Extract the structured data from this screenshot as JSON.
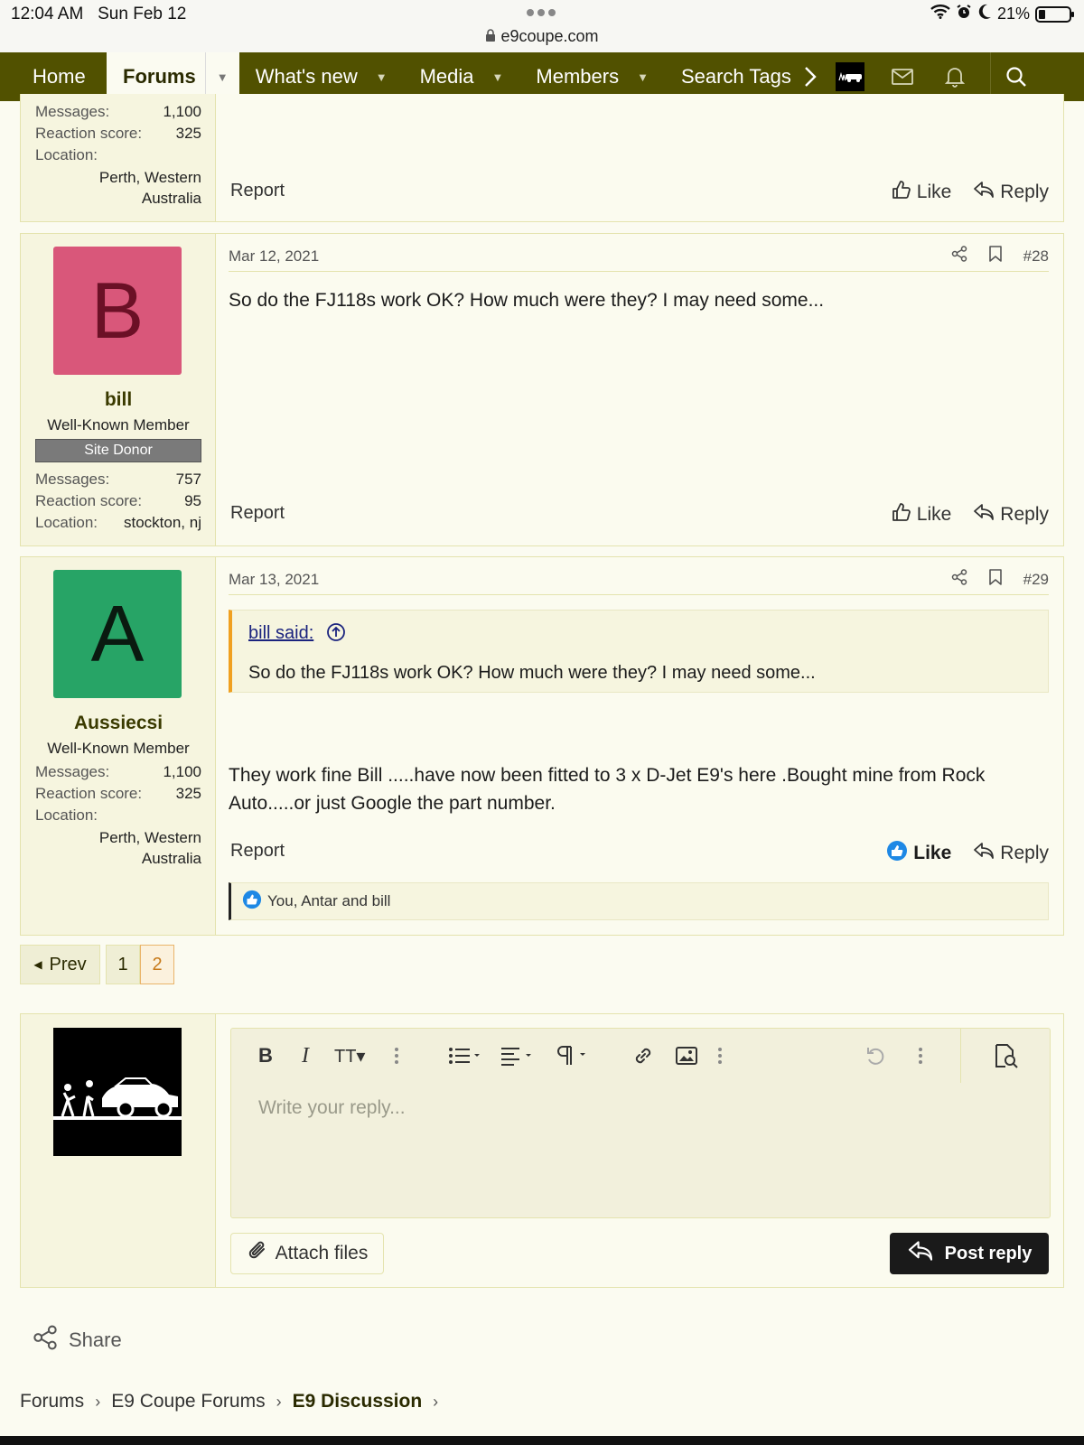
{
  "status_bar": {
    "time": "12:04 AM",
    "date": "Sun Feb 12",
    "url": "e9coupe.com",
    "battery": "21%"
  },
  "nav": {
    "home": "Home",
    "forums": "Forums",
    "whats_new": "What's new",
    "media": "Media",
    "members": "Members",
    "search_tags": "Search Tags"
  },
  "prev_post_footer": {
    "stats": [
      {
        "k": "Messages:",
        "v": "1,100"
      },
      {
        "k": "Reaction score:",
        "v": "325"
      },
      {
        "k": "Location:",
        "v": ""
      }
    ],
    "location_line1": "Perth, Western",
    "location_line2": "Australia",
    "report": "Report",
    "like": "Like",
    "reply": "Reply"
  },
  "post28": {
    "avatar_letter": "B",
    "avatar_bg": "#d9577a",
    "avatar_fg": "#6b1026",
    "username": "bill",
    "user_title": "Well-Known Member",
    "banner": "Site Donor",
    "messages_k": "Messages:",
    "messages_v": "757",
    "reaction_k": "Reaction score:",
    "reaction_v": "95",
    "location_k": "Location:",
    "location_v": "stockton, nj",
    "date": "Mar 12, 2021",
    "number": "#28",
    "body": "So do the FJ118s work OK? How much were they? I may need some...",
    "report": "Report",
    "like": "Like",
    "reply": "Reply"
  },
  "post29": {
    "avatar_letter": "A",
    "avatar_bg": "#27a466",
    "avatar_fg": "#0a1a10",
    "username": "Aussiecsi",
    "user_title": "Well-Known Member",
    "messages_k": "Messages:",
    "messages_v": "1,100",
    "reaction_k": "Reaction score:",
    "reaction_v": "325",
    "location_k": "Location:",
    "location_line1": "Perth, Western",
    "location_line2": "Australia",
    "date": "Mar 13, 2021",
    "number": "#29",
    "quote_author": "bill said:",
    "quote_text": "So do the FJ118s work OK? How much were they? I may need some...",
    "body_line1": "They work fine Bill .....have now been fitted to 3 x D-Jet E9's here .Bought mine from Rock",
    "body_line2": "Auto.....or just Google the part number.",
    "report": "Report",
    "like": "Like",
    "reply": "Reply",
    "reactions_text": "You, Antar and bill"
  },
  "pagination": {
    "prev": "Prev",
    "pages": [
      "1",
      "2"
    ],
    "current": "2"
  },
  "reply_editor": {
    "placeholder": "Write your reply...",
    "attach": "Attach files",
    "post_reply": "Post reply"
  },
  "share": "Share",
  "breadcrumbs": [
    "Forums",
    "E9 Coupe Forums",
    "E9 Discussion"
  ],
  "colors": {
    "nav_bg": "#515100",
    "like_blue": "#1e88e5",
    "quote_border": "#f0a020"
  }
}
